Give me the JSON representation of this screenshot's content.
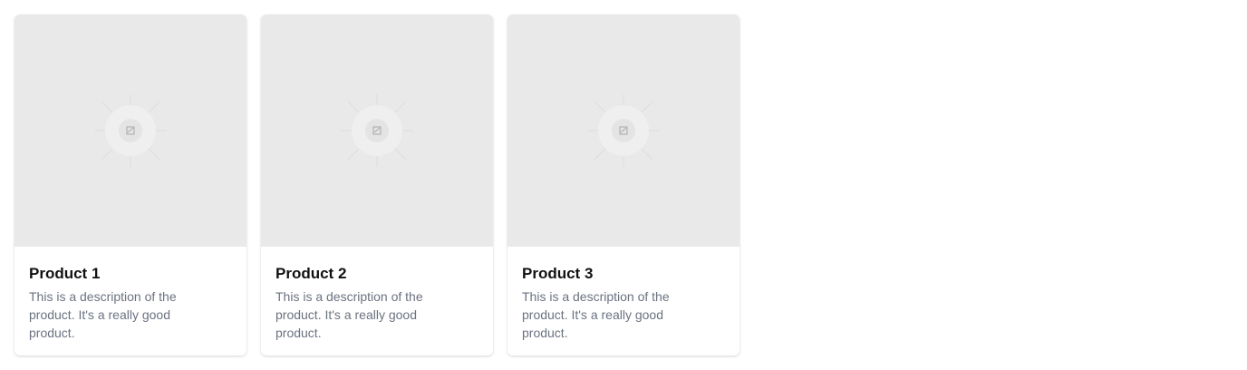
{
  "products": [
    {
      "title": "Product 1",
      "description": "This is a description of the product. It's a really good product.",
      "image_icon": "image-placeholder-icon"
    },
    {
      "title": "Product 2",
      "description": "This is a description of the product. It's a really good product.",
      "image_icon": "image-placeholder-icon"
    },
    {
      "title": "Product 3",
      "description": "This is a description of the product. It's a really good product.",
      "image_icon": "image-placeholder-icon"
    }
  ],
  "colors": {
    "image_background": "#e9e9e9",
    "title": "#111111",
    "description": "#6b7280"
  }
}
